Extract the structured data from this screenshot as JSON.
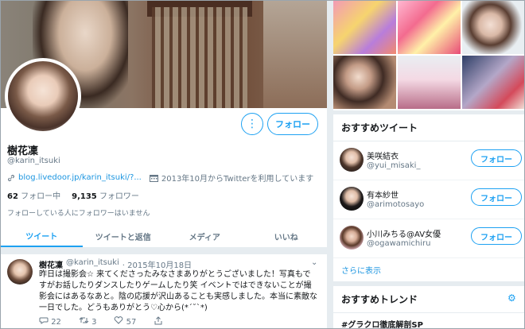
{
  "profile": {
    "name": "樹花凜",
    "handle": "@karin_itsuki",
    "link": "blog.livedoor.jp/karin_itsuki/?...",
    "joined": "2013年10月からTwitterを利用しています",
    "following_count": "62",
    "following_label": "フォロー中",
    "followers_count": "9,135",
    "followers_label": "フォロワー",
    "no_known_followers": "フォローしている人にフォロワーはいません",
    "follow_label": "フォロー",
    "more_symbol": "⋮"
  },
  "tabs": [
    {
      "label": "ツイート",
      "active": true
    },
    {
      "label": "ツイートと返信",
      "active": false
    },
    {
      "label": "メディア",
      "active": false
    },
    {
      "label": "いいね",
      "active": false
    }
  ],
  "tweet": {
    "name": "樹花凜",
    "handle": "@karin_itsuki",
    "date": "· 2015年10月18日",
    "text": "昨日は撮影会☆ 来てくださったみなさまありがとうございました！写真もですがお話したりダンスしたりゲームしたり笑 イベントではできないことが撮影会にはあるなあと。陰の応援が沢山あることも実感しました。本当に素敵な一日でした。どうもありがとう♡心から(*´˘`*)",
    "replies": "22",
    "retweets": "3",
    "likes": "57"
  },
  "who_to_follow": {
    "title": "おすすめツイート",
    "users": [
      {
        "name": "美咲結衣",
        "handle": "@yui_misaki_",
        "button": "フォロー"
      },
      {
        "name": "有本紗世",
        "handle": "@arimotosayo",
        "button": "フォロー"
      },
      {
        "name": "小川みちる@AV女優",
        "handle": "@ogawamichiru",
        "button": "フォロー"
      }
    ],
    "more": "さらに表示"
  },
  "trends": {
    "title": "おすすめトレンド",
    "items": [
      "#グラクロ徹底解剖SP"
    ]
  },
  "colors": {
    "accent": "#1da1f2",
    "link": "#1b95e0",
    "muted": "#657786",
    "background": "#e6ecf0"
  }
}
